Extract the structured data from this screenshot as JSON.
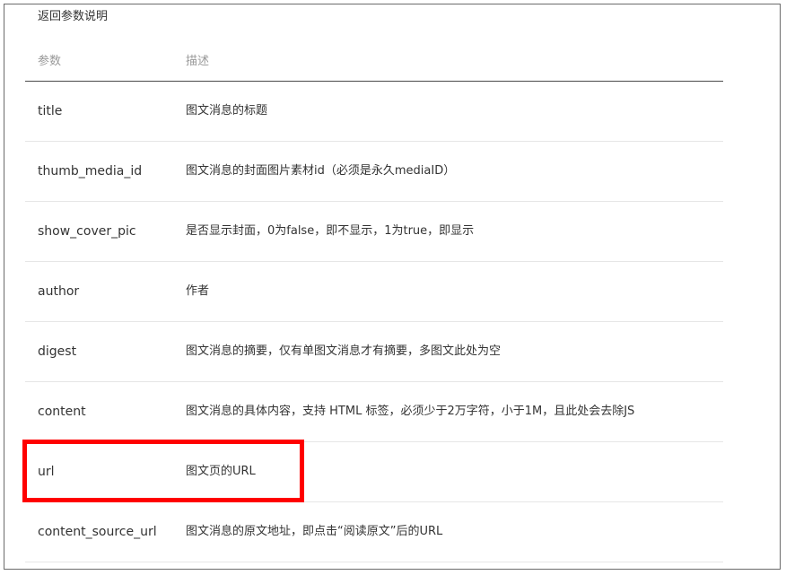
{
  "caption": "返回参数说明",
  "columns": {
    "param": "参数",
    "desc": "描述"
  },
  "rows": [
    {
      "param": "title",
      "desc": "图文消息的标题"
    },
    {
      "param": "thumb_media_id",
      "desc": "图文消息的封面图片素材id（必须是永久mediaID）"
    },
    {
      "param": "show_cover_pic",
      "desc": "是否显示封面，0为false，即不显示，1为true，即显示"
    },
    {
      "param": "author",
      "desc": "作者"
    },
    {
      "param": "digest",
      "desc": "图文消息的摘要，仅有单图文消息才有摘要，多图文此处为空"
    },
    {
      "param": "content",
      "desc": "图文消息的具体内容，支持 HTML 标签，必须少于2万字符，小于1M，且此处会去除JS"
    },
    {
      "param": "url",
      "desc": "图文页的URL"
    },
    {
      "param": "content_source_url",
      "desc": "图文消息的原文地址，即点击“阅读原文”后的URL"
    }
  ],
  "highlight_color": "#ff0000",
  "highlighted_row": "url"
}
